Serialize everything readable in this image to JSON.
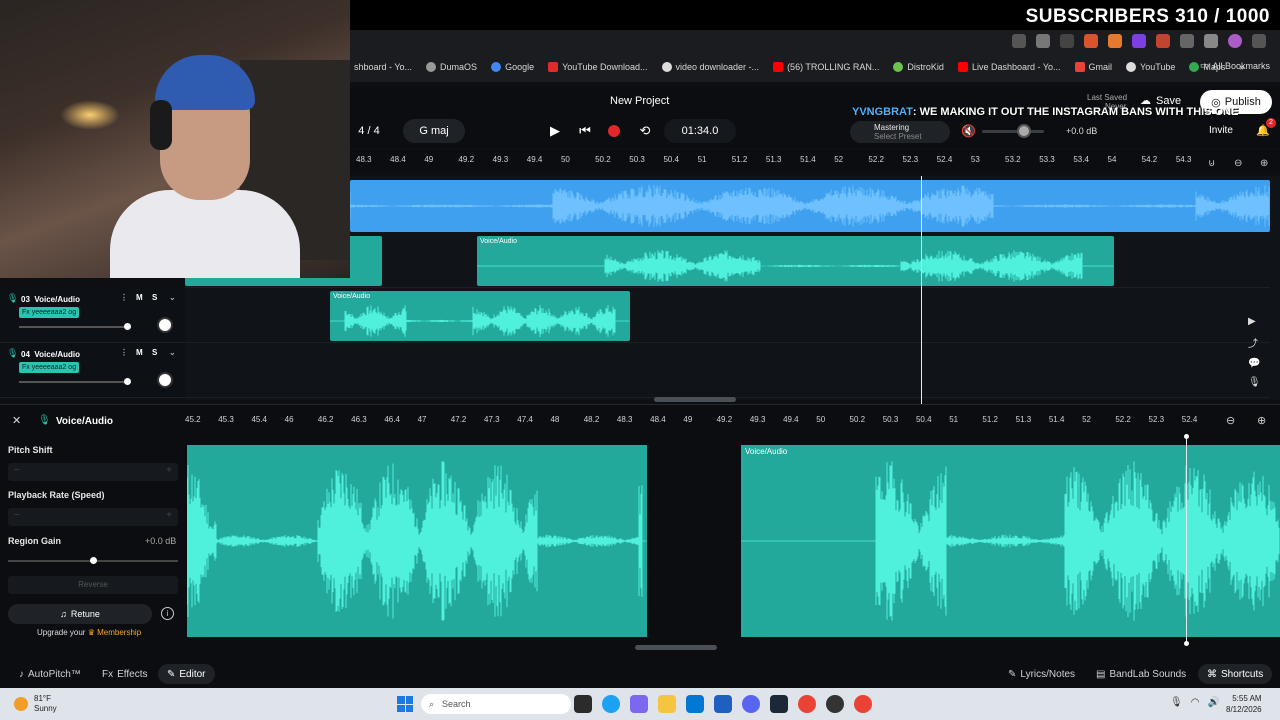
{
  "overlay": {
    "subscribers": "SUBSCRIBERS 310 / 1000"
  },
  "chat": {
    "user": "YVNGBRAT",
    "message": ": WE MAKING IT OUT THE INSTAGRAM BANS WITH THIS ONE"
  },
  "bookmarks": {
    "items": [
      "shboard - Yo...",
      "DumaOS",
      "Google",
      "YouTube Download...",
      "video downloader -...",
      "(56) TROLLING RAN...",
      "DistroKid",
      "Live Dashboard - Yo...",
      "Gmail",
      "YouTube",
      "Maps"
    ],
    "all_label": "All Bookmarks"
  },
  "project": {
    "title": "New Project",
    "track_count": "4 / 4",
    "key": "G maj",
    "time": "01:34.0",
    "last_saved_label": "Last Saved",
    "last_saved_value": "Never",
    "save_label": "Save",
    "publish_label": "Publish",
    "mastering_label": "Mastering",
    "mastering_preset": "Select Preset",
    "volume_db": "+0.0 dB",
    "invite_label": "Invite",
    "notif_count": "2"
  },
  "top_ruler": [
    "48.3",
    "48.4",
    "49",
    "49.2",
    "49.3",
    "49.4",
    "50",
    "50.2",
    "50.3",
    "50.4",
    "51",
    "51.2",
    "51.3",
    "51.4",
    "52",
    "52.2",
    "52.3",
    "52.4",
    "53",
    "53.2",
    "53.3",
    "53.4",
    "54",
    "54.2",
    "54.3"
  ],
  "tracks": [
    {
      "number": "03",
      "name": "Voice/Audio",
      "fx": "Fx yeeeeaaa2 og",
      "mute": "M",
      "solo": "S"
    },
    {
      "number": "04",
      "name": "Voice/Audio",
      "fx": "Fx yeeeeaaa2 og",
      "mute": "M",
      "solo": "S"
    }
  ],
  "clips": {
    "label": "Voice/Audio"
  },
  "editor": {
    "title": "Voice/Audio",
    "pitch_shift": "Pitch Shift",
    "playback_rate": "Playback Rate (Speed)",
    "region_gain": "Region Gain",
    "region_gain_value": "+0.0 dB",
    "reverse": "Reverse",
    "retune": "Retune",
    "upgrade_prefix": "Upgrade your",
    "upgrade_link": "Membership",
    "minus": "−",
    "plus": "+"
  },
  "editor_ruler": [
    "45.2",
    "45.3",
    "45.4",
    "46",
    "46.2",
    "46.3",
    "46.4",
    "47",
    "47.2",
    "47.3",
    "47.4",
    "48",
    "48.2",
    "48.3",
    "48.4",
    "49",
    "49.2",
    "49.3",
    "49.4",
    "50",
    "50.2",
    "50.3",
    "50.4",
    "51",
    "51.2",
    "51.3",
    "51.4",
    "52",
    "52.2",
    "52.3",
    "52.4"
  ],
  "bottom_tabs": {
    "autopitch": "AutoPitch™",
    "effects": "Effects",
    "editor": "Editor",
    "lyrics": "Lyrics/Notes",
    "sounds": "BandLab Sounds",
    "shortcuts": "Shortcuts"
  },
  "taskbar": {
    "temp": "81°F",
    "condition": "Sunny",
    "search": "Search",
    "time": "5:55 AM",
    "date": "8/12/2026"
  },
  "colors": {
    "teal": "#23a99b",
    "blue": "#3ea0ee",
    "record": "#e3262b"
  }
}
